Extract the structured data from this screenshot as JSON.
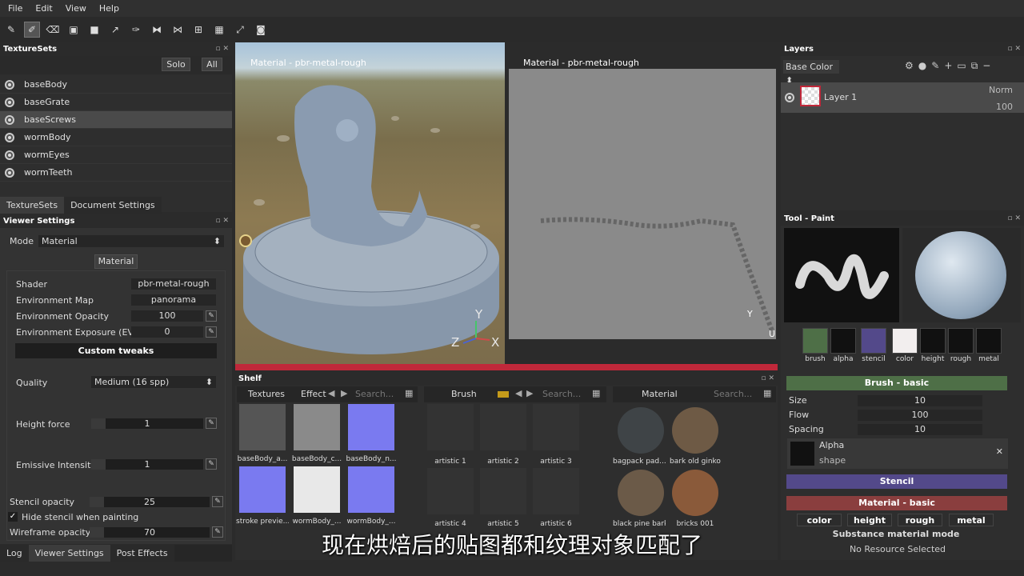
{
  "menu": [
    "File",
    "Edit",
    "View",
    "Help"
  ],
  "toolbar_icons": [
    "paint-brush",
    "eraser",
    "projection",
    "polygon-fill",
    "smudge",
    "clone",
    "eyedropper",
    "mirror",
    "symmetry",
    "camera-toggle",
    "viewport-split",
    "fit-view",
    "screenshot"
  ],
  "texturesets": {
    "title": "TextureSets",
    "solo": "Solo",
    "all": "All",
    "items": [
      "baseBody",
      "baseGrate",
      "baseScrews",
      "wormBody",
      "wormEyes",
      "wormTeeth"
    ],
    "selected": 2,
    "tabs": [
      "TextureSets",
      "Document Settings"
    ]
  },
  "viewer_settings": {
    "title": "Viewer Settings",
    "mode_label": "Mode",
    "mode_value": "Material",
    "material_btn": "Material",
    "shader_label": "Shader",
    "shader_value": "pbr-metal-rough",
    "env_map_label": "Environment Map",
    "env_map_value": "panorama",
    "env_opacity_label": "Environment Opacity",
    "env_opacity_value": "100",
    "env_exposure_label": "Environment Exposure (EV)",
    "env_exposure_value": "0",
    "custom_tweaks": "Custom tweaks",
    "quality_label": "Quality",
    "quality_value": "Medium (16 spp)",
    "height_force_label": "Height force",
    "height_force_value": "1",
    "emissive_label": "Emissive Intensity",
    "emissive_value": "1",
    "stencil_opacity_label": "Stencil opacity",
    "stencil_opacity_value": "25",
    "hide_stencil_label": "Hide stencil when painting",
    "wireframe_label": "Wireframe opacity",
    "wireframe_value": "70"
  },
  "bottom_tabs": [
    "Log",
    "Viewer Settings",
    "Post Effects"
  ],
  "viewport3d": {
    "label": "Material - pbr-metal-rough",
    "axes": [
      "Y",
      "Z",
      "X"
    ]
  },
  "viewport2d": {
    "label": "Material - pbr-metal-rough",
    "axes": [
      "Y",
      "U"
    ]
  },
  "shelf": {
    "title": "Shelf",
    "textures_tab": "Textures",
    "effects_tab": "Effect",
    "brush_tab": "Brush",
    "material_tab": "Material",
    "search_placeholder": "Search...",
    "textures": [
      "baseBody_a...",
      "baseBody_c...",
      "baseBody_n...",
      "stroke previe...",
      "wormBody_...",
      "wormBody_..."
    ],
    "brushes": [
      "artistic 1",
      "artistic 2",
      "artistic 3",
      "artistic 4",
      "artistic 5",
      "artistic 6"
    ],
    "materials": [
      "bagpack pad...",
      "bark old ginko",
      "black pine bark",
      "bricks 001"
    ]
  },
  "layers": {
    "title": "Layers",
    "channel": "Base Color",
    "layer_name": "Layer 1",
    "blend": "Norm",
    "opacity": "100"
  },
  "tool": {
    "title": "Tool - Paint",
    "channels": [
      "brush",
      "alpha",
      "stencil",
      "color",
      "height",
      "rough",
      "metal"
    ]
  },
  "brush_basic": {
    "title": "Brush - basic",
    "size_label": "Size",
    "size_value": "10",
    "flow_label": "Flow",
    "flow_value": "100",
    "spacing_label": "Spacing",
    "spacing_value": "10",
    "alpha_label": "Alpha",
    "alpha_sub": "shape"
  },
  "stencil": {
    "title": "Stencil"
  },
  "material_basic": {
    "title": "Material - basic",
    "channels": [
      "color",
      "height",
      "rough",
      "metal"
    ],
    "mode_label": "Substance material mode",
    "resource": "No Resource Selected"
  },
  "subtitle": "现在烘焙后的贴图都和纹理对象匹配了",
  "colors": {
    "brush_green": "#4e6f47",
    "stencil_purple": "#53498a",
    "material_red": "#8a3e3e",
    "timeline_red": "#c0283a"
  }
}
